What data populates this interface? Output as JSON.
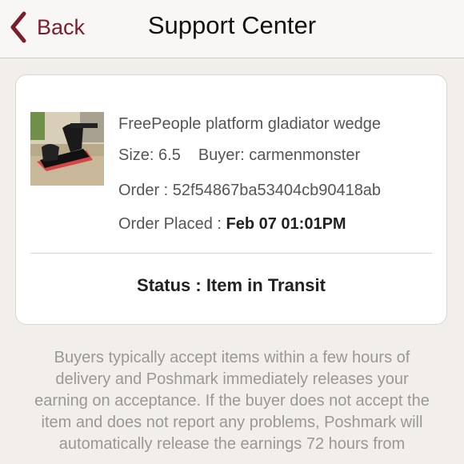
{
  "nav": {
    "back_label": "Back",
    "title": "Support Center"
  },
  "order": {
    "item_title": "FreePeople platform gladiator wedge",
    "size_label": "Size: 6.5",
    "buyer_label": "Buyer: carmenmonster",
    "order_id_label": "Order : 52f54867ba53404cb90418ab",
    "placed_label": "Order Placed : ",
    "placed_value": "Feb 07 01:01PM",
    "status_label": "Status : Item in Transit"
  },
  "info_lines": [
    "Buyers typically accept items within a few hours of",
    "delivery and Poshmark immediately releases your",
    "earning on acceptance. If the buyer does not accept the",
    "item and does not report any problems, Poshmark will",
    "automatically release the earnings 72 hours from"
  ],
  "colors": {
    "accent": "#7a1e2c",
    "background": "#f2efea"
  }
}
